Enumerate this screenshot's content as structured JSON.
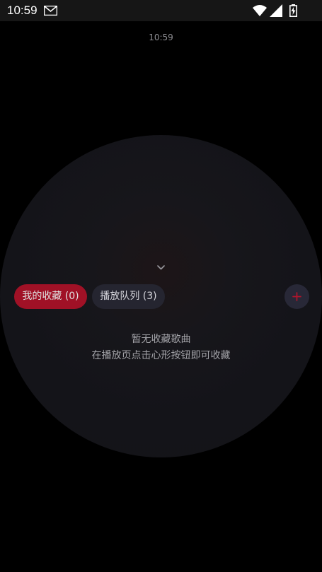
{
  "status_bar": {
    "time": "10:59",
    "icons": [
      "mail-icon",
      "wifi-icon",
      "signal-icon",
      "battery-icon"
    ]
  },
  "player": {
    "clock": "10:59"
  },
  "tabs": [
    {
      "label": "我的收藏 (0)",
      "active": true
    },
    {
      "label": "播放队列 (3)",
      "active": false
    }
  ],
  "add_button": {
    "icon": "plus-icon"
  },
  "empty_state": {
    "title": "暂无收藏歌曲",
    "hint": "在播放页点击心形按钮即可收藏"
  },
  "colors": {
    "background": "#000000",
    "accent": "#a01126",
    "tab_inactive": "#252530",
    "disc": "#141419"
  }
}
